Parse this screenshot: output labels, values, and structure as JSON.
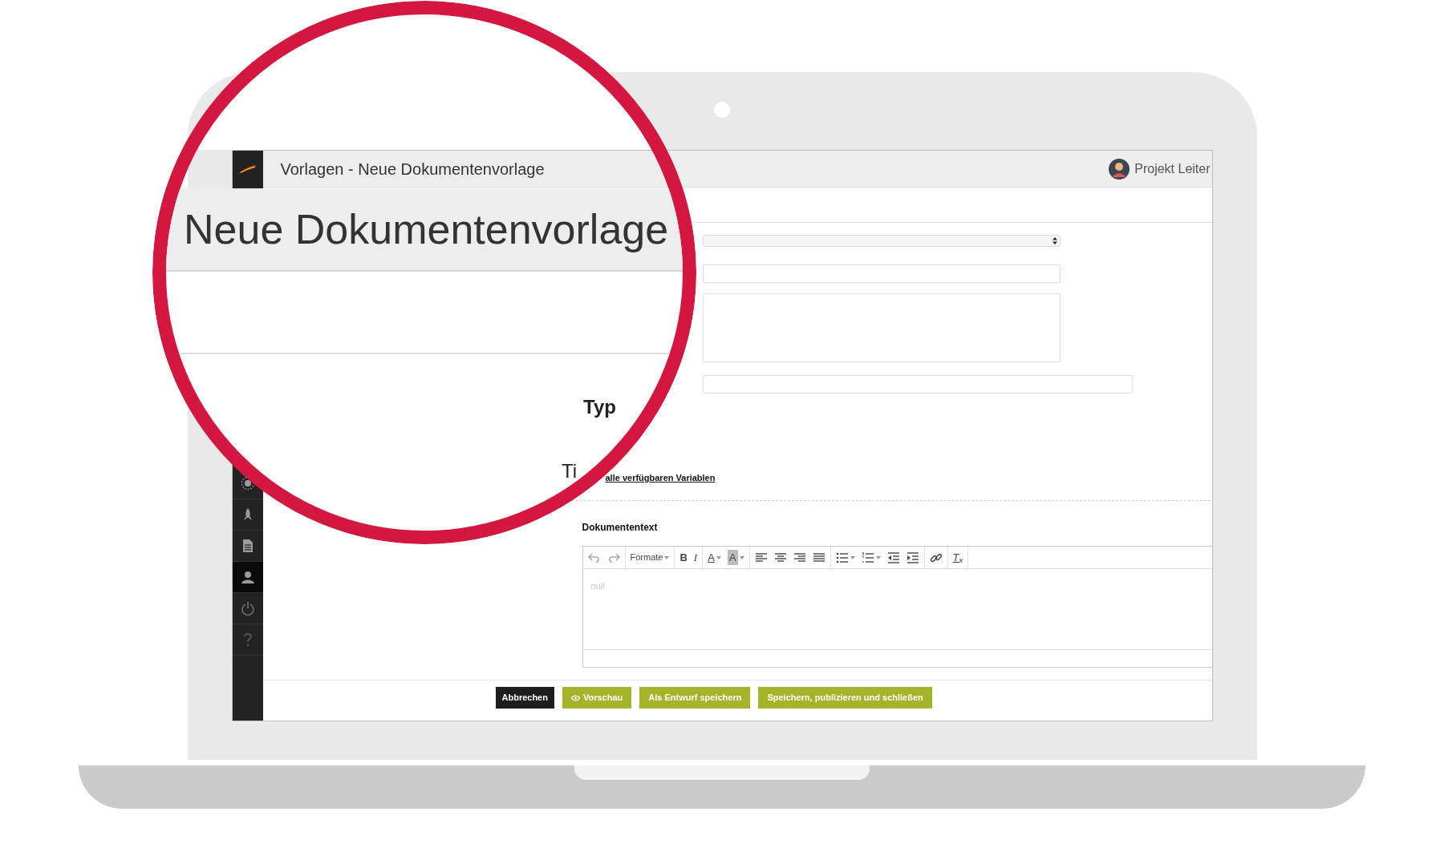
{
  "header": {
    "title": "Vorlagen - Neue Dokumentenvorlage",
    "user": "Projekt Leiter"
  },
  "sidebar": {
    "items": [
      {
        "kind": "sun",
        "selected": false
      },
      {
        "kind": "rocket",
        "selected": false
      },
      {
        "kind": "document",
        "selected": false
      },
      {
        "kind": "user",
        "selected": true
      },
      {
        "kind": "power",
        "selected": false
      },
      {
        "kind": "help",
        "selected": false
      }
    ]
  },
  "form": {
    "fields": [
      {
        "kind": "select"
      },
      {
        "kind": "input"
      },
      {
        "kind": "textarea"
      },
      {
        "kind": "input-wide"
      }
    ],
    "variables_label": "Ti",
    "variables_link": "alle verfügbaren Variablen"
  },
  "magnifier": {
    "heading": "Neue Dokumentenvorlage",
    "label": "Typ"
  },
  "editor": {
    "label": "Dokumententext",
    "placeholder": "null",
    "toolbar": [
      [
        {
          "kind": "undo"
        },
        {
          "kind": "redo"
        }
      ],
      [
        {
          "kind": "formats",
          "label": "Formate"
        }
      ],
      [
        {
          "kind": "bold",
          "label": "B"
        },
        {
          "kind": "italic",
          "label": "I"
        }
      ],
      [
        {
          "kind": "textcolor",
          "label": "A"
        },
        {
          "kind": "backcolor",
          "label": "A"
        }
      ],
      [
        {
          "kind": "alignleft"
        },
        {
          "kind": "aligncenter"
        },
        {
          "kind": "alignright"
        },
        {
          "kind": "alignjustify"
        }
      ],
      [
        {
          "kind": "bullist"
        },
        {
          "kind": "numlist"
        },
        {
          "kind": "outdent"
        },
        {
          "kind": "indent"
        }
      ],
      [
        {
          "kind": "link"
        }
      ],
      [
        {
          "kind": "removeformat",
          "label": "T$_{x}$"
        }
      ]
    ]
  },
  "buttons": [
    {
      "kind": "dark",
      "label": "Abbrechen"
    },
    {
      "kind": "preview",
      "label": "Vorschau"
    },
    {
      "kind": "green",
      "label": "Als Entwurf speichern"
    },
    {
      "kind": "green",
      "label": "Speichern, publizieren und schließen"
    }
  ]
}
